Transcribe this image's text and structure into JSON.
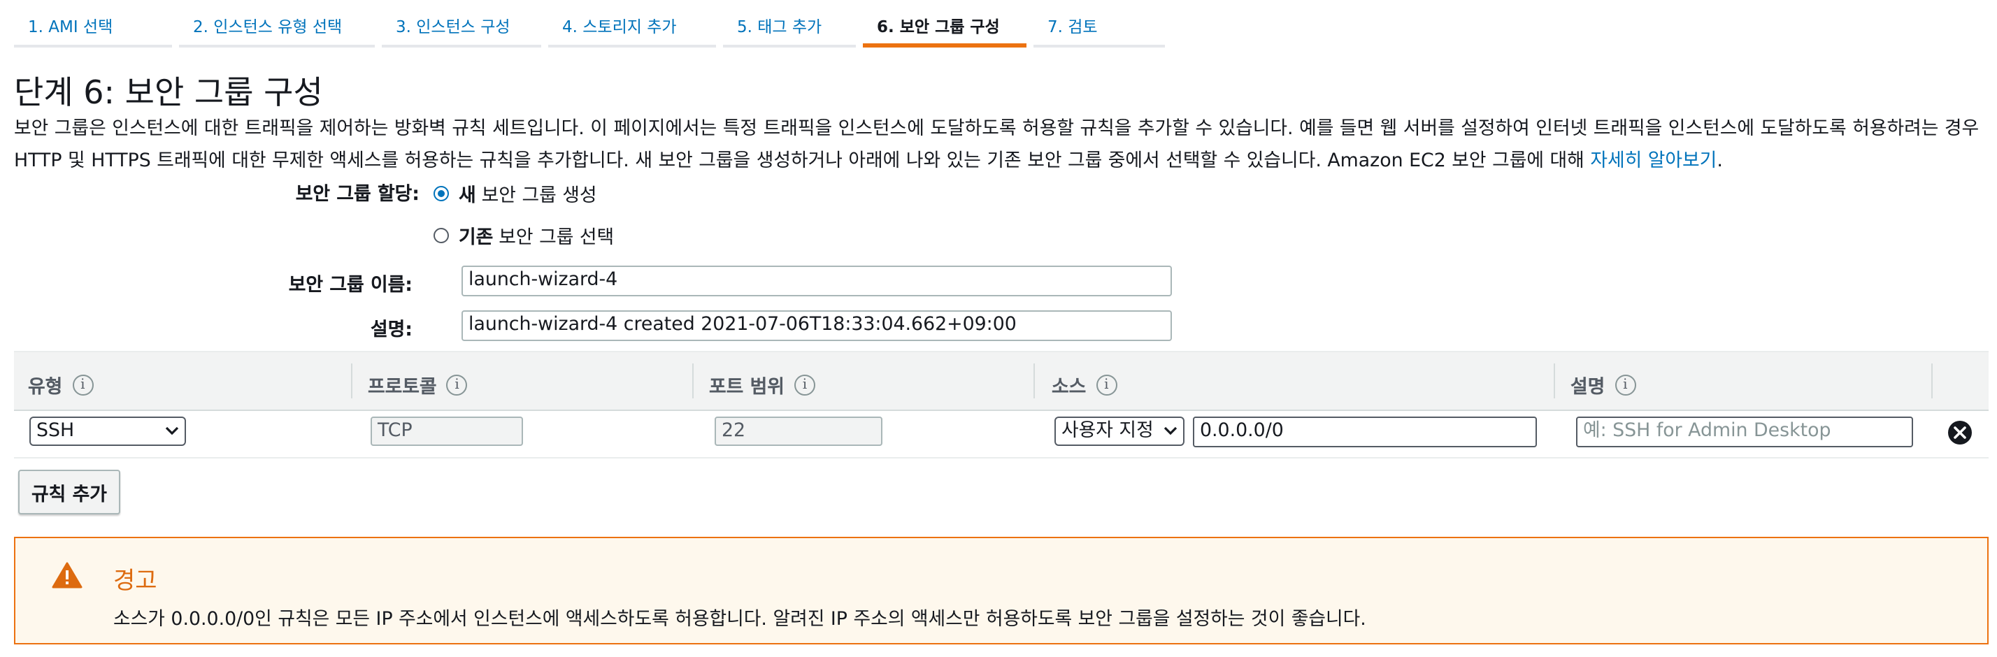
{
  "steps": [
    {
      "label": "1. AMI 선택"
    },
    {
      "label": "2. 인스턴스 유형 선택"
    },
    {
      "label": "3. 인스턴스 구성"
    },
    {
      "label": "4. 스토리지 추가"
    },
    {
      "label": "5. 태그 추가"
    },
    {
      "label": "6. 보안 그룹 구성"
    },
    {
      "label": "7. 검토"
    }
  ],
  "active_step": 6,
  "page": {
    "title": "단계 6: 보안 그룹 구성",
    "intro": "보안 그룹은 인스턴스에 대한 트래픽을 제어하는 방화벽 규칙 세트입니다. 이 페이지에서는 특정 트래픽을 인스턴스에 도달하도록 허용할 규칙을 추가할 수 있습니다. 예를 들면 웹 서버를 설정하여 인터넷 트래픽을 인스턴스에 도달하도록 허용하려는 경우 HTTP 및 HTTPS 트래픽에 대한 무제한 액세스를 허용하는 규칙을 추가합니다. 새 보안 그룹을 생성하거나 아래에 나와 있는 기존 보안 그룹 중에서 선택할 수 있습니다. Amazon EC2 보안 그룹에 대해 ",
    "learn_more": "자세히 알아보기",
    "intro_end": "."
  },
  "assign": {
    "label": "보안 그룹 할당:",
    "option_new_bold": "새",
    "option_new_rest": "보안 그룹 생성",
    "option_existing_bold": "기존",
    "option_existing_rest": "보안 그룹 선택",
    "selected": "new"
  },
  "name_field": {
    "label": "보안 그룹 이름:",
    "value": "launch-wizard-4"
  },
  "desc_field": {
    "label": "설명:",
    "value": "launch-wizard-4 created 2021-07-06T18:33:04.662+09:00"
  },
  "table": {
    "headers": [
      "유형",
      "프로토콜",
      "포트 범위",
      "소스",
      "설명"
    ],
    "info_glyph": "i",
    "rows": [
      {
        "type": "SSH",
        "protocol": "TCP",
        "port": "22",
        "source_mode": "사용자 지정",
        "source_cidr": "0.0.0.0/0",
        "description_placeholder": "예: SSH for Admin Desktop"
      }
    ]
  },
  "add_rule_label": "규칙 추가",
  "warning": {
    "title": "경고",
    "text": "소스가 0.0.0.0/0인 규칙은 모든 IP 주소에서 인스턴스에 액세스하도록 허용합니다. 알려진 IP 주소의 액세스만 허용하도록 보안 그룹을 설정하는 것이 좋습니다."
  },
  "colors": {
    "link": "#0073bb",
    "accent": "#ec7211",
    "warning_bg": "#fef8ed",
    "warning_title": "#dd6b10"
  }
}
